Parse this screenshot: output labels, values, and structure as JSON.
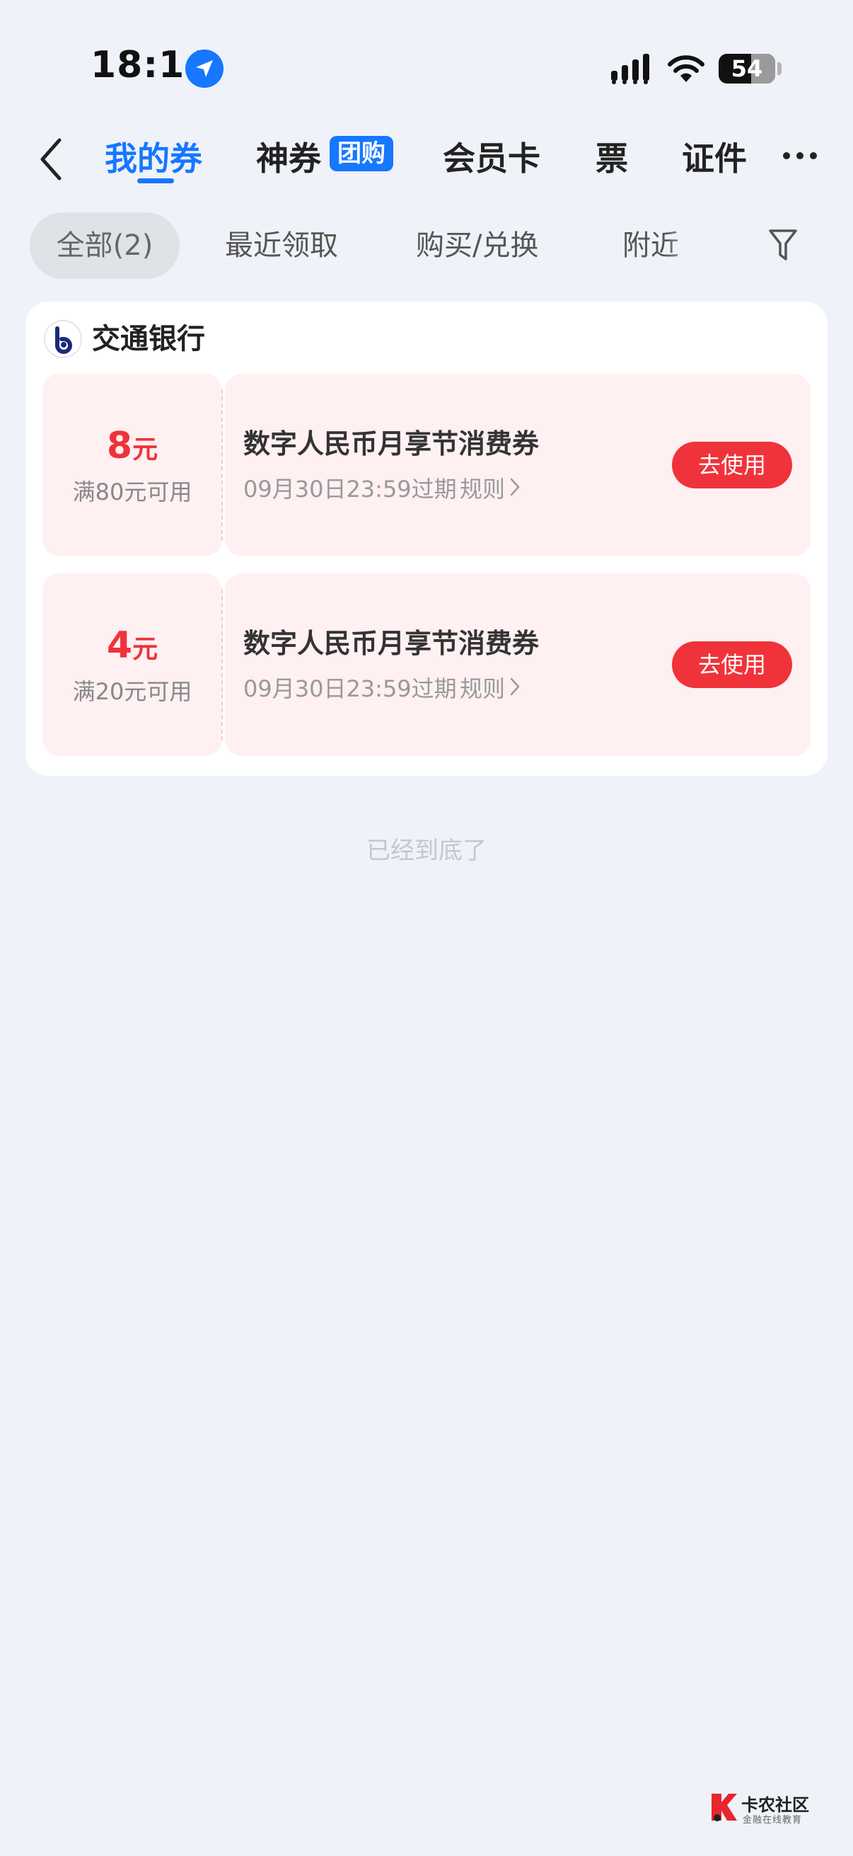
{
  "status_bar": {
    "time": "18:14",
    "battery_level": "54"
  },
  "nav": {
    "tabs": [
      {
        "label": "我的券"
      },
      {
        "label": "神券"
      },
      {
        "label": "会员卡"
      },
      {
        "label": "票"
      },
      {
        "label": "证件"
      }
    ],
    "tuangou_badge": "团购",
    "active_tab": "我的券"
  },
  "filters": {
    "items": [
      {
        "label": "全部(2)"
      },
      {
        "label": "最近领取"
      },
      {
        "label": "购买/兑换"
      },
      {
        "label": "附近"
      }
    ]
  },
  "bank": {
    "name": "交通银行"
  },
  "coupons": [
    {
      "amount": "8",
      "unit": "元",
      "condition": "满80元可用",
      "title": "数字人民币月享节消费券",
      "expiry": "09月30日23:59过期",
      "rules_label": "规则",
      "action_label": "去使用"
    },
    {
      "amount": "4",
      "unit": "元",
      "condition": "满20元可用",
      "title": "数字人民币月享节消费券",
      "expiry": "09月30日23:59过期",
      "rules_label": "规则",
      "action_label": "去使用"
    }
  ],
  "footer": {
    "end_text": "已经到底了"
  },
  "watermark": {
    "title": "卡农社区",
    "subtitle": "金融在线教育"
  },
  "colors": {
    "accent": "#1677ff",
    "coupon_red": "#f0333a",
    "coupon_bg": "#fff0f2",
    "page_bg": "#eff2f8"
  }
}
